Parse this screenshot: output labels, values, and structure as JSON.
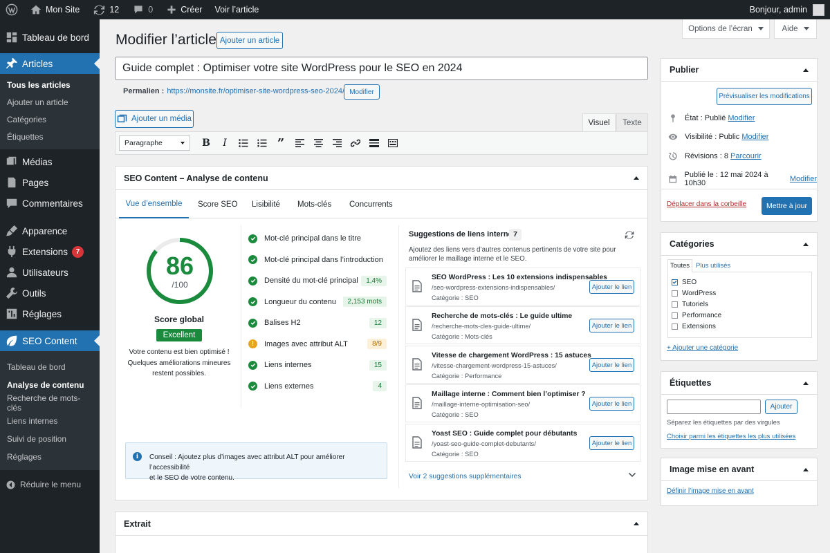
{
  "adminbar": {
    "site_name": "Mon Site",
    "updates_count": "12",
    "comments_count": "0",
    "new_label": "Créer",
    "view_label": "Voir l’article",
    "greeting": "Bonjour, admin"
  },
  "sidebar": {
    "items": [
      {
        "label": "Tableau de bord",
        "icon": "dashboard-icon"
      },
      {
        "label": "Articles",
        "icon": "pin-icon"
      },
      {
        "label": "Médias",
        "icon": "media-icon"
      },
      {
        "label": "Pages",
        "icon": "page-icon"
      },
      {
        "label": "Commentaires",
        "icon": "comment-icon"
      },
      {
        "label": "Apparence",
        "icon": "brush-icon"
      },
      {
        "label": "Extensions",
        "icon": "plugin-icon",
        "badge": "7"
      },
      {
        "label": "Utilisateurs",
        "icon": "user-icon"
      },
      {
        "label": "Outils",
        "icon": "wrench-icon"
      },
      {
        "label": "Réglages",
        "icon": "settings-icon"
      },
      {
        "label": "SEO Content",
        "icon": "leaf-icon"
      }
    ],
    "articles_sub": [
      "Tous les articles",
      "Ajouter un article",
      "Catégories",
      "Étiquettes"
    ],
    "seo_sub": [
      "Tableau de bord",
      "Analyse de contenu",
      "Recherche de mots-clés",
      "Liens internes",
      "Suivi de position",
      "Réglages"
    ],
    "collapse_label": "Réduire le menu"
  },
  "top": {
    "screen_options": "Options de l’écran",
    "help": "Aide"
  },
  "page": {
    "title": "Modifier l’article",
    "add_new": "Ajouter un article",
    "post_title": "Guide complet : Optimiser votre site WordPress pour le SEO en 2024",
    "permalink_label": "Permalien :",
    "permalink_url": "https://monsite.fr/optimiser-site-wordpress-seo-2024/",
    "permalink_edit": "Modifier"
  },
  "editor": {
    "add_media": "Ajouter un média",
    "tab_visual": "Visuel",
    "tab_text": "Texte",
    "format_select": "Paragraphe"
  },
  "seo_box": {
    "title": "SEO Content – Analyse de contenu",
    "tabs": [
      "Vue d’ensemble",
      "Score SEO",
      "Lisibilité",
      "Mots-clés",
      "Concurrents"
    ],
    "score": 86,
    "score_max": "/100",
    "score_label": "Score global",
    "score_badge": "Excellent",
    "score_desc": [
      "Votre contenu est bien optimisé !",
      "Quelques améliorations mineures",
      "restent possibles."
    ],
    "checks": [
      {
        "label": "Mot-clé principal dans le titre",
        "status": "ok",
        "value": ""
      },
      {
        "label": "Mot-clé principal dans l’introduction",
        "status": "ok",
        "value": ""
      },
      {
        "label": "Densité du mot-clé principal",
        "status": "ok",
        "value": "1,4%"
      },
      {
        "label": "Longueur du contenu",
        "status": "ok",
        "value": "2,153 mots"
      },
      {
        "label": "Balises H2",
        "status": "ok",
        "value": "12"
      },
      {
        "label": "Images avec attribut ALT",
        "status": "warn",
        "value": "8/9"
      },
      {
        "label": "Liens internes",
        "status": "ok",
        "value": "15"
      },
      {
        "label": "Liens externes",
        "status": "ok",
        "value": "4"
      }
    ],
    "tip_label": "Conseil :",
    "tip_text": "Ajoutez plus d’images avec attribut ALT pour améliorer l’accessibilité",
    "tip_text2": "et le SEO de votre contenu.",
    "suggestions_title": "Suggestions de liens internes",
    "suggestions_count": "7",
    "suggestions_desc": [
      "Ajoutez des liens vers d’autres contenus pertinents de votre site pour",
      "améliorer le maillage interne et le SEO."
    ],
    "suggestions": [
      {
        "title": "SEO WordPress : Les 10 extensions indispensables",
        "url": "/seo-wordpress-extensions-indispensables/",
        "category": "Catégorie : SEO"
      },
      {
        "title": "Recherche de mots-clés : Le guide ultime",
        "url": "/recherche-mots-cles-guide-ultime/",
        "category": "Catégorie : Mots-clés"
      },
      {
        "title": "Vitesse de chargement WordPress : 15 astuces",
        "url": "/vitesse-chargement-wordpress-15-astuces/",
        "category": "Catégorie : Performance"
      },
      {
        "title": "Maillage interne : Comment bien l’optimiser ?",
        "url": "/maillage-interne-optimisation-seo/",
        "category": "Catégorie : SEO"
      },
      {
        "title": "Yoast SEO : Guide complet pour débutants",
        "url": "/yoast-seo-guide-complet-debutants/",
        "category": "Catégorie : SEO"
      }
    ],
    "add_link_label": "Ajouter le lien",
    "more_suggestions": "Voir 2 suggestions supplémentaires"
  },
  "excerpt": {
    "title": "Extrait"
  },
  "publish": {
    "title": "Publier",
    "preview": "Prévisualiser les modifications",
    "status": "État : Publié",
    "visibility": "Visibilité : Public",
    "revisions": "Révisions : 8",
    "published": "Publié le : 12 mai 2024 à 10h30",
    "edit": "Modifier",
    "browse": "Parcourir",
    "trash": "Déplacer dans la corbeille",
    "update": "Mettre à jour"
  },
  "categories": {
    "title": "Catégories",
    "tab_all": "Toutes",
    "tab_used": "Plus utilisés",
    "items": [
      {
        "label": "SEO",
        "checked": true
      },
      {
        "label": "WordPress",
        "checked": false
      },
      {
        "label": "Tutoriels",
        "checked": false
      },
      {
        "label": "Performance",
        "checked": false
      },
      {
        "label": "Extensions",
        "checked": false
      }
    ],
    "add": "+ Ajouter une catégorie"
  },
  "tags": {
    "title": "Étiquettes",
    "add": "Ajouter",
    "hint": "Séparez les étiquettes par des virgules",
    "choose": "Choisir parmi les étiquettes les plus utilisées"
  },
  "featured": {
    "title": "Image mise en avant",
    "set": "Définir l’image mise en avant"
  },
  "colors": {
    "accent": "#2271b1",
    "success": "#1a8a3c",
    "warning": "#e9a41f",
    "danger": "#d63638"
  }
}
